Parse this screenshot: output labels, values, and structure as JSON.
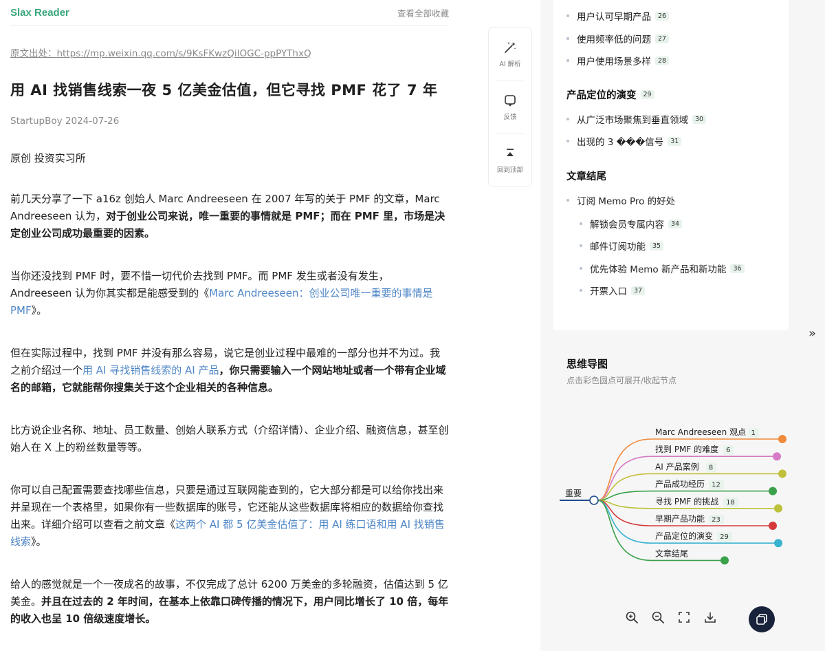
{
  "header": {
    "brand": "Slax Reader",
    "all_bookmarks": "查看全部收藏"
  },
  "article": {
    "source_prefix": "原文出处：",
    "source_url": "https://mp.weixin.qq.com/s/9KsFKwzQiIOGC-ppPYThxQ",
    "title": "用 AI 找销售线索一夜 5 亿美金估值，但它寻找 PMF 花了 7 年",
    "author_date": "StartupBoy 2024-07-26",
    "byline": "原创 投资实习所",
    "p1_a": "前几天分享了一下 a16z 创始人 Marc Andreeseen 在 2007 年写的关于 PMF 的文章，Marc Andreeseen 认为，",
    "p1_b": "对于创业公司来说，唯一重要的事情就是 PMF；而在 PMF 里，市场是决定创业公司成功最重要的因素。",
    "p2_a": "当你还没找到 PMF 时，要不惜一切代价去找到 PMF。而 PMF 发生或者没有发生，Andreeseen 认为你其实都是能感受到的《",
    "p2_link": "Marc Andreeseen：创业公司唯一重要的事情是 PMF",
    "p2_b": "》。",
    "p3_a": "但在实际过程中，找到 PMF 并没有那么容易，说它是创业过程中最难的一部分也并不为过。我之前介绍过一个",
    "p3_link": "用 AI 寻找销售线索的 AI 产品",
    "p3_b": "，你只需要输入一个网站地址或者一个带有企业域名的邮箱，它就能帮你搜集关于这个企业相关的各种信息。",
    "p4": "比方说企业名称、地址、员工数量、创始人联系方式（介绍详情）、企业介绍、融资信息，甚至创始人在 X 上的粉丝数量等等。",
    "p5_a": "你可以自己配置需要查找哪些信息，只要是通过互联网能查到的，它大部分都是可以给你找出来并呈现在一个表格里，如果你有一些数据库的账号，它还能从这些数据库将相应的数据给你查找出来。详细介绍可以查看之前文章《",
    "p5_link": "这两个 AI 都 5 亿美金估值了：用 AI 练口语和用 AI 找销售线索",
    "p5_b": "》。",
    "p6_a": "给人的感觉就是一个一夜成名的故事，不仅完成了总计 6200 万美金的多轮融资，估值达到 5 亿美金。",
    "p6_b": "并且在过去的 2 年时间，在基本上依靠口碑传播的情况下，用户同比增长了 10 倍，每年的收入也呈 10 倍级速度增长。"
  },
  "toolbar": {
    "ai": "AI 解析",
    "feedback": "反馈",
    "top": "回到顶部"
  },
  "outline": {
    "items_top": [
      {
        "label": "用户认可早期产品",
        "num": "26"
      },
      {
        "label": "使用频率低的问题",
        "num": "27"
      },
      {
        "label": "用户使用场景多样",
        "num": "28"
      }
    ],
    "heading1": {
      "label": "产品定位的演变",
      "num": "29"
    },
    "items_mid": [
      {
        "label": "从广泛市场聚焦到垂直领域",
        "num": "30"
      },
      {
        "label": "出现的 3 ���信号",
        "num": "31"
      }
    ],
    "heading2": {
      "label": "文章结尾"
    },
    "item_sub_head": {
      "label": "订阅 Memo Pro 的好处"
    },
    "items_sub": [
      {
        "label": "解锁会员专属内容",
        "num": "34"
      },
      {
        "label": "邮件订阅功能",
        "num": "35"
      },
      {
        "label": "优先体验 Memo 新产品和新功能",
        "num": "36"
      },
      {
        "label": "开票入口",
        "num": "37"
      }
    ]
  },
  "expand_icon": "»",
  "mindmap": {
    "title": "思维导图",
    "subtitle": "点击彩色圆点可展开/收起节点",
    "root": "重要",
    "branches": [
      {
        "label": "Marc Andreeseen 观点",
        "num": "1",
        "color": "#f08a3c"
      },
      {
        "label": "找到 PMF 的难度",
        "num": "6",
        "color": "#d77ac7"
      },
      {
        "label": "AI 产品案例",
        "num": "8",
        "color": "#c2bf3a"
      },
      {
        "label": "产品成功经历",
        "num": "12",
        "color": "#3aa14a"
      },
      {
        "label": "寻找 PMF 的挑战",
        "num": "18",
        "color": "#bcc23a"
      },
      {
        "label": "早期产品功能",
        "num": "23",
        "color": "#d43a3a"
      },
      {
        "label": "产品定位的演变",
        "num": "29",
        "color": "#39b3cf"
      },
      {
        "label": "文章结尾",
        "num": "",
        "color": "#3aa14a"
      }
    ]
  },
  "mm_controls": [
    "zoom-in-icon",
    "zoom-out-icon",
    "fullscreen-icon",
    "download-icon"
  ]
}
